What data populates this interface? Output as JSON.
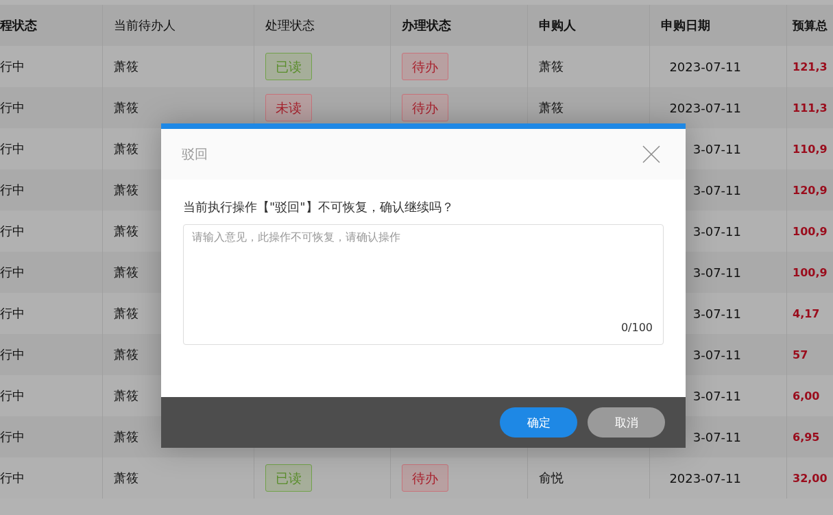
{
  "table": {
    "columns": [
      {
        "label": "程状态",
        "bold": true
      },
      {
        "label": "当前待办人",
        "bold": false
      },
      {
        "label": "处理状态",
        "bold": false
      },
      {
        "label": "办理状态",
        "bold": true
      },
      {
        "label": "申购人",
        "bold": true
      },
      {
        "label": "申购日期",
        "bold": true
      },
      {
        "label": "预算总",
        "bold": true
      }
    ],
    "rows": [
      {
        "flow_status": "行中",
        "assignee": "萧筱",
        "read_status": {
          "label": "已读",
          "read": true
        },
        "handle_status": "待办",
        "applicant": "萧筱",
        "date": "2023-07-11",
        "amount": "121,3"
      },
      {
        "flow_status": "行中",
        "assignee": "萧筱",
        "read_status": {
          "label": "未读",
          "read": false
        },
        "handle_status": "待办",
        "applicant": "萧筱",
        "date": "2023-07-11",
        "amount": "111,3"
      },
      {
        "flow_status": "行中",
        "assignee": "萧筱",
        "date": "3-07-11",
        "amount": "110,9"
      },
      {
        "flow_status": "行中",
        "assignee": "萧筱",
        "date": "3-07-11",
        "amount": "120,9"
      },
      {
        "flow_status": "行中",
        "assignee": "萧筱",
        "date": "3-07-11",
        "amount": "100,9"
      },
      {
        "flow_status": "行中",
        "assignee": "萧筱",
        "date": "3-07-11",
        "amount": "100,9"
      },
      {
        "flow_status": "行中",
        "assignee": "萧筱",
        "date": "3-07-11",
        "amount": "4,17"
      },
      {
        "flow_status": "行中",
        "assignee": "萧筱",
        "date": "3-07-11",
        "amount": "57"
      },
      {
        "flow_status": "行中",
        "assignee": "萧筱",
        "date": "3-07-11",
        "amount": "6,00"
      },
      {
        "flow_status": "行中",
        "assignee": "萧筱",
        "date": "3-07-11",
        "amount": "6,95"
      },
      {
        "flow_status": "行中",
        "assignee": "萧筱",
        "read_status": {
          "label": "已读",
          "read": true
        },
        "handle_status": "待办",
        "applicant": "俞悦",
        "date": "2023-07-11",
        "amount": "32,00"
      }
    ]
  },
  "dialog": {
    "title": "驳回",
    "message": "当前执行操作【\"驳回\"】不可恢复，确认继续吗？",
    "comment_field": {
      "placeholder": "请输入意见，此操作不可恢复，请确认操作",
      "counter": "0/100"
    },
    "buttons": [
      {
        "label": "确定",
        "kind": "primary"
      },
      {
        "label": "取消",
        "kind": "secondary"
      }
    ]
  }
}
